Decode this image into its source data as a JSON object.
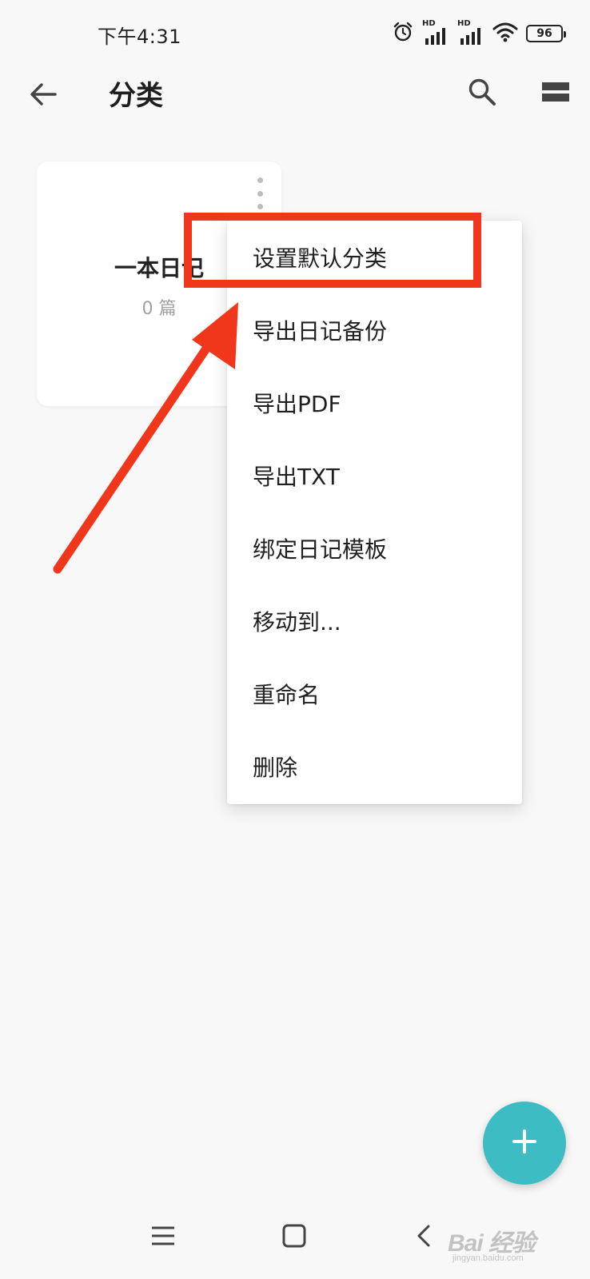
{
  "status_bar": {
    "time": "下午4:31",
    "signal_1_label": "HD",
    "signal_2_label": "HD",
    "battery": "96",
    "icons": [
      "alarm-icon",
      "signal-icon",
      "signal-icon",
      "wifi-icon",
      "battery-icon"
    ]
  },
  "app_bar": {
    "title": "分类",
    "icons": [
      "arrow-left-icon",
      "search-icon",
      "view-toggle-icon"
    ]
  },
  "category_card": {
    "title": "一本日记",
    "count": "0 篇"
  },
  "menu": {
    "items": [
      "设置默认分类",
      "导出日记备份",
      "导出PDF",
      "导出TXT",
      "绑定日记模板",
      "移动到...",
      "重命名",
      "删除"
    ]
  },
  "annotation": {
    "color": "#f0361b"
  },
  "fab": {
    "icon": "plus-icon",
    "color": "#3dbcc3"
  },
  "nav_bar": {
    "icons": [
      "menu-icon",
      "home-icon",
      "back-icon"
    ]
  },
  "watermark": {
    "main": "Bai 经验",
    "sub": "jingyan.baidu.com"
  }
}
